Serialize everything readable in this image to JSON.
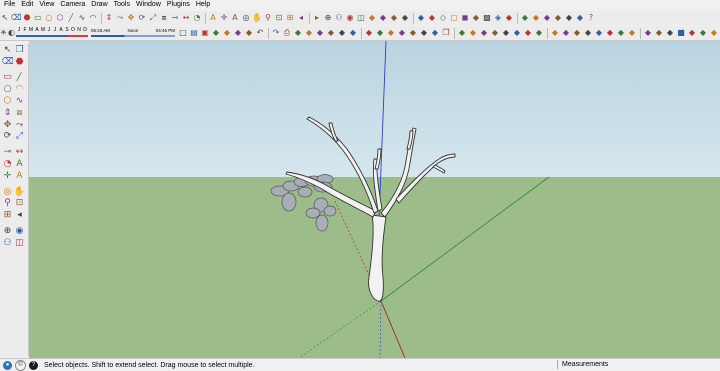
{
  "menu": [
    "File",
    "Edit",
    "View",
    "Camera",
    "Draw",
    "Tools",
    "Window",
    "Plugins",
    "Help"
  ],
  "shadow_settings": {
    "months": [
      "J",
      "F",
      "M",
      "A",
      "M",
      "J",
      "J",
      "A",
      "S",
      "O",
      "N",
      "D"
    ],
    "time_start": "06:43 AM",
    "noon": "Noon",
    "time_end": "04:46 PM"
  },
  "toolbar_icons_row1": [
    "select-icon",
    "eraser-icon",
    "paint-icon",
    "rectangle-icon",
    "circle-icon",
    "polygon-icon",
    "line-icon",
    "freehand-icon",
    "arc-icon",
    "push-pull-icon",
    "follow-me-icon",
    "move-icon",
    "rotate-icon",
    "scale-icon",
    "offset-icon",
    "tape-measure-icon",
    "dimension-icon",
    "protractor-icon",
    "text-icon",
    "axes-icon",
    "3d-text-icon",
    "orbit-icon",
    "pan-icon",
    "zoom-icon",
    "zoom-window-icon",
    "zoom-extents-icon",
    "previous-view-icon",
    "next-view-icon",
    "position-camera-icon",
    "walk-icon",
    "look-around-icon",
    "section-plane-icon",
    "iso-view-icon",
    "top-view-icon",
    "front-view-icon",
    "right-view-icon",
    "back-view-icon",
    "left-view-icon",
    "x-ray-icon",
    "wireframe-icon",
    "hidden-line-icon",
    "shaded-icon",
    "textured-icon",
    "monochrome-icon",
    "get-models-icon",
    "share-model-icon",
    "share-component-icon",
    "ge-icon",
    "photo-texture-icon",
    "preview-icon",
    "record-icon",
    "help-icon"
  ],
  "toolbar_icons_row2": [
    "new-icon",
    "open-icon",
    "save-icon",
    "cut-icon",
    "copy-icon",
    "paste-icon",
    "erase-icon",
    "undo-icon",
    "redo-icon",
    "print-icon",
    "model-info-icon",
    "layer-icon",
    "color-by-layer-icon",
    "outliner-icon",
    "scene-icon",
    "section-cuts-icon",
    "display-section-icon",
    "camera-icon",
    "soften-edges-icon",
    "match-photo-icon",
    "fog-icon",
    "edge-style-icon",
    "face-style-icon",
    "component-icon",
    "group-icon",
    "make-component-icon",
    "intersect-icon",
    "solid-union-icon",
    "solid-subtract-icon",
    "solid-trim-icon",
    "solid-split-icon",
    "outer-shell-icon",
    "sandbox-icon",
    "contours-icon",
    "smoove-icon",
    "stamp-icon",
    "drape-icon",
    "add-detail-icon",
    "flip-edge-icon",
    "dynamic-component-icon",
    "interact-icon",
    "component-options-icon",
    "component-attributes-icon",
    "stop-icon",
    "warehouse-icon",
    "extension-icon",
    "ruby-icon"
  ],
  "left_tools": [
    [
      "select-icon",
      "component-icon"
    ],
    [
      "eraser-icon",
      "paint-bucket-icon"
    ],
    [
      "rectangle-icon",
      "line-icon"
    ],
    [
      "circle-icon",
      "arc-icon"
    ],
    [
      "polygon-icon",
      "freehand-icon"
    ],
    [
      "push-pull-icon",
      "offset-icon"
    ],
    [
      "move-icon",
      "follow-me-icon"
    ],
    [
      "rotate-icon",
      "scale-icon"
    ],
    [
      "tape-measure-icon",
      "dimension-icon"
    ],
    [
      "protractor-icon",
      "text-icon"
    ],
    [
      "axes-icon",
      "3d-text-icon"
    ],
    [
      "orbit-icon",
      "pan-icon"
    ],
    [
      "zoom-icon",
      "zoom-window-icon"
    ],
    [
      "zoom-extents-icon",
      "previous-view-icon"
    ],
    [
      "position-camera-icon",
      "look-around-icon"
    ],
    [
      "walk-icon",
      "section-plane-icon"
    ]
  ],
  "status": {
    "message": "Select objects. Shift to extend select. Drag mouse to select multiple.",
    "measurements_label": "Measurements"
  },
  "colors": {
    "sky_top": "#b8d4e0",
    "sky_bottom": "#d6e6ee",
    "ground": "#9cbd8a",
    "axis_blue": "#2b3fd6",
    "axis_red": "#a0281a",
    "axis_green": "#2a8a2a",
    "tree_fill": "#f2f2f2",
    "leaf_fill": "#a8aeb5"
  }
}
